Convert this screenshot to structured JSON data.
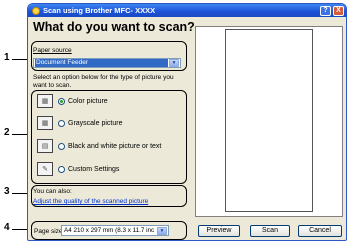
{
  "window": {
    "title": "Scan using Brother MFC- XXXX",
    "help_button": "?",
    "close_button": "X"
  },
  "heading": "What do you want to scan?",
  "paper_source": {
    "label": "Paper source",
    "value": "Document Feeder",
    "dropdown_arrow": "▼"
  },
  "options_prompt": "Select an option below for the type of picture you want to scan.",
  "options": [
    {
      "label": "Color picture",
      "selected": true,
      "icon": "color-picture-icon"
    },
    {
      "label": "Grayscale picture",
      "selected": false,
      "icon": "grayscale-picture-icon"
    },
    {
      "label": "Black and white picture or text",
      "selected": false,
      "icon": "bw-text-icon"
    },
    {
      "label": "Custom Settings",
      "selected": false,
      "icon": "custom-settings-icon"
    }
  ],
  "also": {
    "label": "You can also:",
    "link": "Adjust the quality of the scanned picture"
  },
  "page_size": {
    "label": "Page size:",
    "value": "A4 210 x 297 mm (8.3 x 11.7 inc",
    "dropdown_arrow": "▼"
  },
  "buttons": {
    "preview": "Preview",
    "scan": "Scan",
    "cancel": "Cancel"
  },
  "callouts": [
    "1",
    "2",
    "3",
    "4"
  ]
}
